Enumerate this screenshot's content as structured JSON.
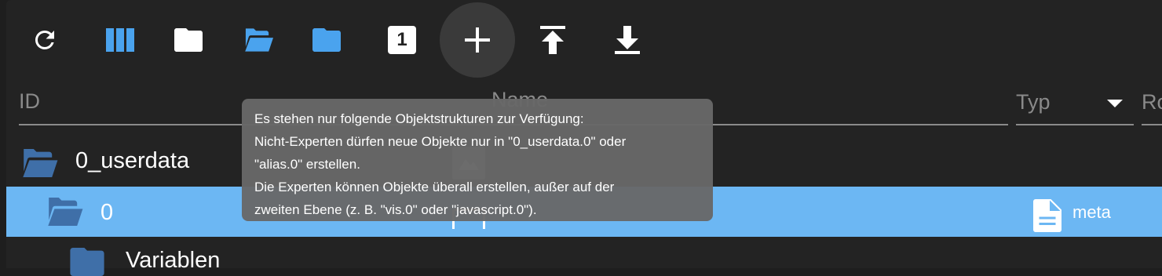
{
  "toolbar": {
    "buttons": [
      {
        "name": "refresh",
        "icon": "refresh-icon"
      },
      {
        "name": "columns",
        "icon": "columns-icon"
      },
      {
        "name": "collapse-all",
        "icon": "folder-icon"
      },
      {
        "name": "expand-all",
        "icon": "folder-open-icon"
      },
      {
        "name": "expand-one-step",
        "icon": "folder-icon"
      },
      {
        "name": "level",
        "icon": "level-one-icon",
        "label": "1"
      },
      {
        "name": "add-object",
        "icon": "plus-icon"
      },
      {
        "name": "upload",
        "icon": "upload-icon"
      },
      {
        "name": "download",
        "icon": "download-icon"
      }
    ],
    "level_label": "1"
  },
  "header": {
    "id": "ID",
    "name": "Name",
    "typ": "Typ",
    "role": "Ro"
  },
  "rows": [
    {
      "label": "0_userdata"
    },
    {
      "label": "0",
      "name_fragment": "[hidden]",
      "type": "meta",
      "selected": true
    },
    {
      "label": "Variablen"
    }
  ],
  "tooltip": {
    "lines": [
      "Es stehen nur folgende Objektstrukturen zur Verfügung:",
      "Nicht-Experten dürfen neue Objekte nur in \"0_userdata.0\" oder",
      "\"alias.0\" erstellen.",
      "Die Experten können Objekte überall erstellen, außer auf der",
      "zweiten Ebene (z. B. \"vis.0\" oder \"javascript.0\")."
    ]
  },
  "colors": {
    "accent_blue": "#4aa3ee",
    "selected_row": "#6cb7f3",
    "folder_dark": "#3f6fa8",
    "background": "#232323"
  }
}
